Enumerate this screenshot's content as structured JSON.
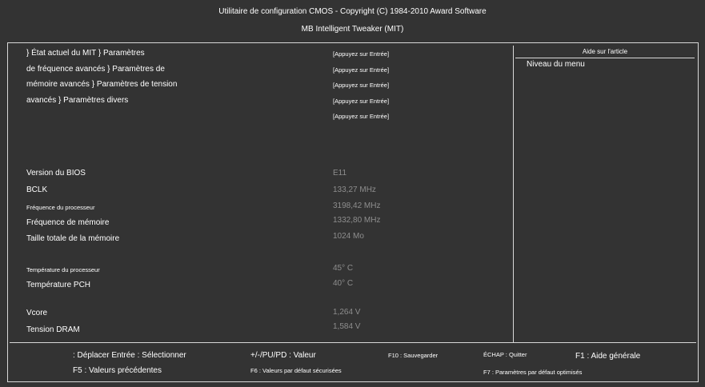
{
  "header": {
    "title": "Utilitaire de configuration CMOS - Copyright (C) 1984-2010 Award Software",
    "subtitle": "MB Intelligent Tweaker (MIT)"
  },
  "menu": {
    "items": [
      "} État actuel du MIT } Paramètres",
      "de fréquence avancés } Paramètres de",
      "mémoire avancés } Paramètres de tension",
      "avancés } Paramètres divers"
    ],
    "press_enter": [
      "[Appuyez sur Entrée]",
      "[Appuyez sur Entrée]",
      "[Appuyez sur Entrée]",
      "[Appuyez sur Entrée]",
      "[Appuyez sur Entrée]"
    ]
  },
  "info": {
    "bios_version_label": "Version du BIOS",
    "bios_version_value": "E11",
    "bclk_label": "BCLK",
    "bclk_value": "133,27 MHz",
    "cpu_freq_label": "Fréquence du processeur",
    "cpu_freq_value": "3198,42 MHz",
    "mem_freq_label": "Fréquence de mémoire",
    "mem_freq_value": "1332,80 MHz",
    "mem_total_label": "Taille totale de la mémoire",
    "mem_total_value": "1024 Mo",
    "cpu_temp_label": "Température du processeur",
    "cpu_temp_value": "45° C",
    "pch_temp_label": "Température PCH",
    "pch_temp_value": "40° C",
    "vcore_label": "Vcore",
    "vcore_value": "1,264 V",
    "dram_label": "Tension DRAM",
    "dram_value": "1,584 V"
  },
  "help": {
    "title": "Aide sur l'article",
    "text": "Niveau du menu"
  },
  "footer": {
    "move": ": Déplacer Entrée : Sélectionner",
    "value": "+/-/PU/PD : Valeur",
    "save": "F10 : Sauvegarder",
    "quit": "ÉCHAP : Quitter",
    "general_help": "F1 : Aide générale",
    "prev_values": "F5 : Valeurs précédentes",
    "failsafe": "F6 : Valeurs par défaut sécurisées",
    "optimized": "F7 : Paramètres par défaut optimisés"
  }
}
